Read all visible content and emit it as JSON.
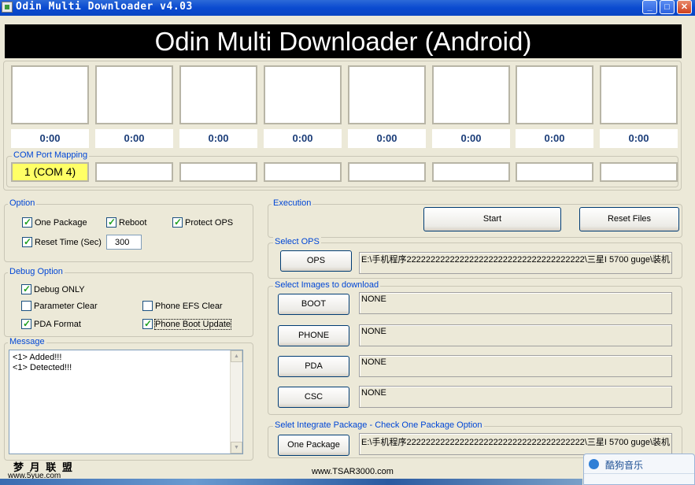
{
  "window": {
    "title": "Odin Multi Downloader v4.03"
  },
  "banner": {
    "text": "Odin Multi Downloader (Android)"
  },
  "ports": {
    "times": [
      "0:00",
      "0:00",
      "0:00",
      "0:00",
      "0:00",
      "0:00",
      "0:00",
      "0:00"
    ],
    "com_label": "COM Port Mapping",
    "com": [
      "1 (COM 4)",
      "",
      "",
      "",
      "",
      "",
      "",
      ""
    ]
  },
  "option": {
    "title": "Option",
    "one_package": "One Package",
    "reboot": "Reboot",
    "protect_ops": "Protect OPS",
    "reset_time": "Reset Time (Sec)",
    "reset_time_value": "300"
  },
  "debug": {
    "title": "Debug Option",
    "debug_only": "Debug ONLY",
    "parameter_clear": "Parameter Clear",
    "phone_efs_clear": "Phone EFS Clear",
    "pda_format": "PDA Format",
    "phone_boot_update": "Phone Boot Update"
  },
  "message": {
    "title": "Message",
    "lines": [
      "<1> Added!!!",
      "<1> Detected!!!"
    ]
  },
  "execution": {
    "title": "Execution",
    "start": "Start",
    "reset_files": "Reset Files"
  },
  "select_ops": {
    "title": "Select OPS",
    "button": "OPS",
    "path": "E:\\手机程序2222222222222222222222222222222222222\\三星I 5700  guge\\装机"
  },
  "images": {
    "title": "Select Images to download",
    "boot": "BOOT",
    "boot_path": "NONE",
    "phone": "PHONE",
    "phone_path": "NONE",
    "pda": "PDA",
    "pda_path": "NONE",
    "csc": "CSC",
    "csc_path": "NONE"
  },
  "integrate": {
    "title": "Selet Integrate Package - Check One Package Option",
    "button": "One Package",
    "path": "E:\\手机程序2222222222222222222222222222222222222\\三星I 5700  guge\\装机"
  },
  "watermarks": {
    "left": "梦 月 联 盟",
    "left_url": "www.5yue.com",
    "center": "www.TSAR3000.com",
    "popup": "酷狗音乐"
  }
}
